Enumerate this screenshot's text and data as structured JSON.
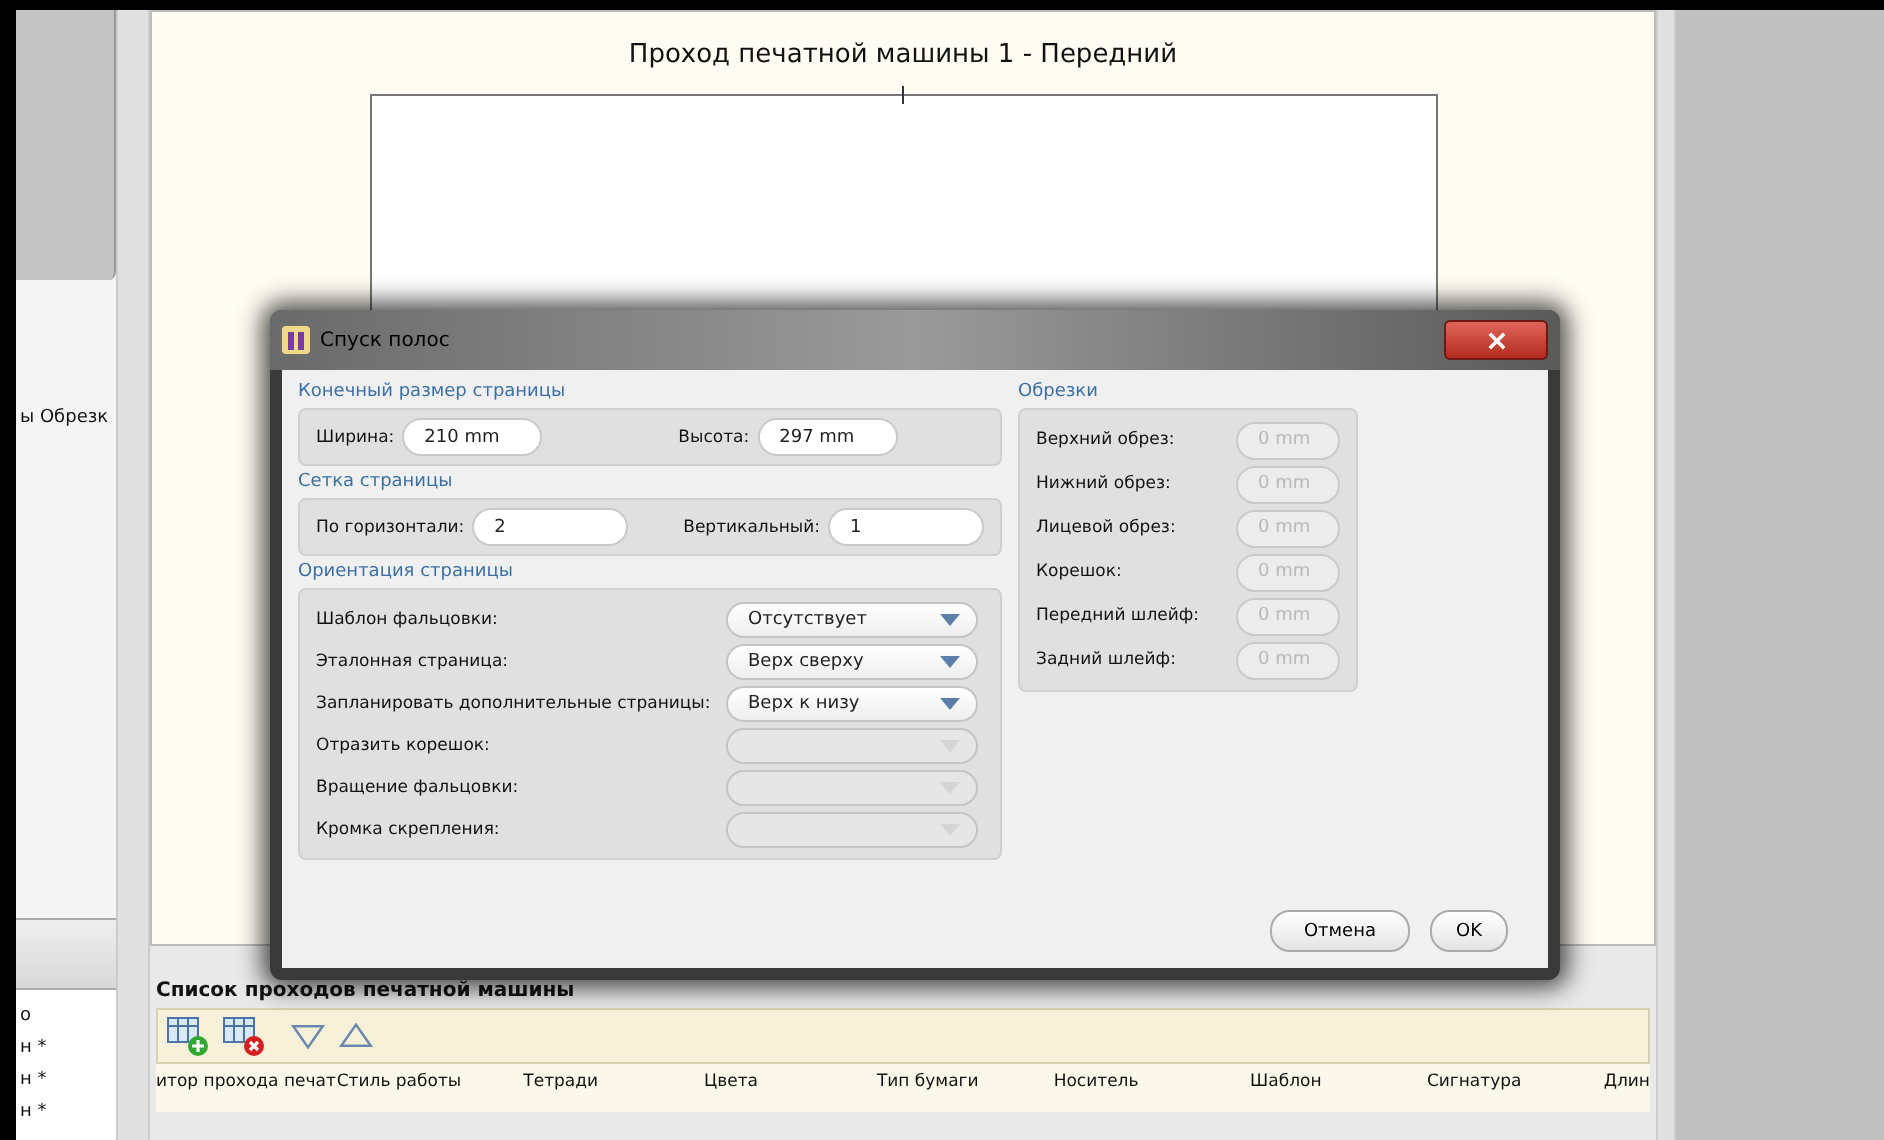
{
  "canvas": {
    "title": "Проход печатной машины 1 - Передний"
  },
  "left_panel": {
    "cut_text": "ы Обрезк",
    "list_items": [
      "о",
      "н *",
      "н *",
      "н *"
    ]
  },
  "dialog": {
    "title": "Спуск полос",
    "size": {
      "label": "Конечный размер страницы",
      "fields": [
        {
          "label": "Ширина:",
          "value": "210 mm"
        },
        {
          "label": "Высота:",
          "value": "297 mm"
        }
      ]
    },
    "grid": {
      "label": "Сетка страницы",
      "fields": [
        {
          "label": "По горизонтали:",
          "value": "2"
        },
        {
          "label": "Вертикальный:",
          "value": "1"
        }
      ]
    },
    "orientation": {
      "label": "Ориентация страницы",
      "rows": [
        {
          "label": "Шаблон фальцовки:",
          "value": "Отсутствует",
          "disabled": false
        },
        {
          "label": "Эталонная страница:",
          "value": "Верх сверху",
          "disabled": false
        },
        {
          "label": "Запланировать дополнительные страницы:",
          "value": "Верх к низу",
          "disabled": false
        },
        {
          "label": "Отразить корешок:",
          "disabled": true
        },
        {
          "label": "Вращение фальцовки:",
          "disabled": true
        },
        {
          "label": "Кромка скрепления:",
          "disabled": true
        }
      ]
    },
    "trims": {
      "label": "Обрезки",
      "rows": [
        {
          "label": "Верхний обрез:",
          "value": "0 mm",
          "disabled": true
        },
        {
          "label": "Нижний обрез:",
          "value": "0 mm",
          "disabled": true
        },
        {
          "label": "Лицевой обрез:",
          "value": "0 mm",
          "disabled": true
        },
        {
          "label": "Корешок:",
          "value": "0 mm",
          "disabled": true
        },
        {
          "label": "Передний шлейф:",
          "value": "0 mm",
          "disabled": true
        },
        {
          "label": "Задний шлейф:",
          "value": "0 mm",
          "disabled": true
        }
      ]
    },
    "buttons": [
      "Отмена",
      "OK"
    ]
  },
  "pass_list": {
    "title": "Список проходов печатной машины",
    "columns": [
      "итор прохода печат",
      "Стиль работы",
      "Тетради",
      "Цвета",
      "Тип бумаги",
      "Носитель",
      "Шаблон",
      "Сигнатура",
      "Длин"
    ]
  }
}
